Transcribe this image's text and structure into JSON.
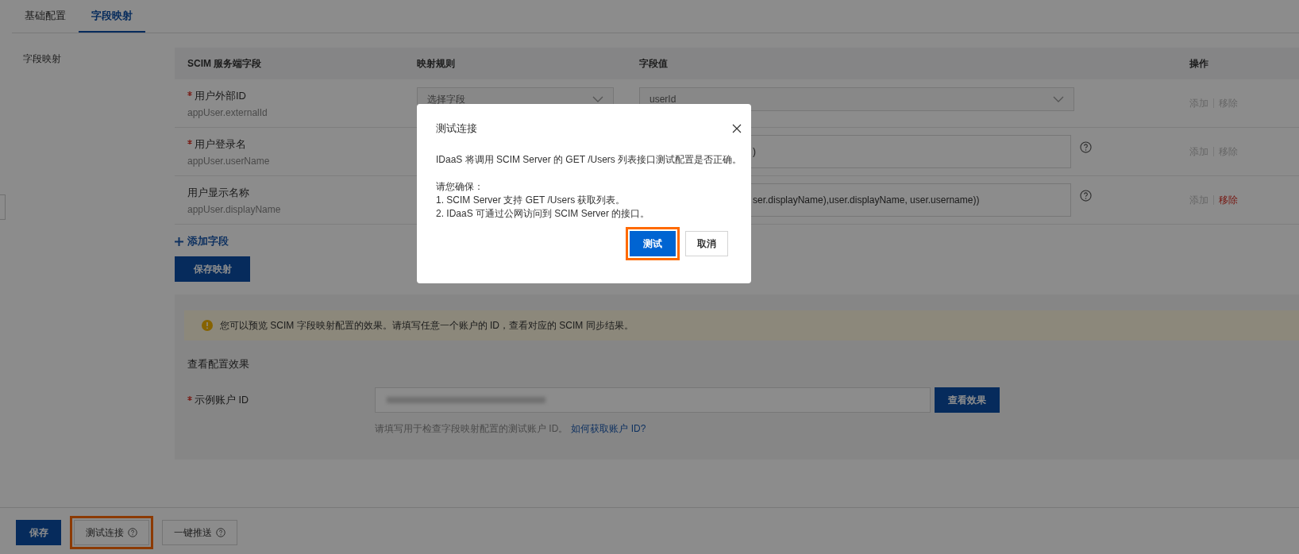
{
  "tabs": [
    {
      "label": "基础配置",
      "selected": false
    },
    {
      "label": "字段映射",
      "selected": true
    }
  ],
  "section_label": "字段映射",
  "table": {
    "columns": [
      "SCIM 服务端字段",
      "映射规则",
      "字段值",
      "操作"
    ],
    "rows": [
      {
        "required": true,
        "name": "用户外部ID",
        "attribute": "appUser.externalId",
        "rule": {
          "kind": "select",
          "placeholder": "选择字段"
        },
        "value": {
          "kind": "select",
          "text": "userId"
        },
        "help": false,
        "actions": [
          {
            "label": "添加",
            "disabled": true
          },
          {
            "label": "移除",
            "disabled": true
          }
        ]
      },
      {
        "required": true,
        "name": "用户登录名",
        "attribute": "appUser.userName",
        "value": {
          "kind": "text",
          "text": ")"
        },
        "help": true,
        "actions": [
          {
            "label": "添加",
            "disabled": true
          },
          {
            "label": "移除",
            "disabled": true
          }
        ]
      },
      {
        "required": false,
        "name": "用户显示名称",
        "attribute": "appUser.displayName",
        "value": {
          "kind": "text",
          "text": "ser.displayName),user.displayName, user.username))"
        },
        "help": true,
        "actions": [
          {
            "label": "添加",
            "disabled": true
          },
          {
            "label": "移除",
            "disabled": false
          }
        ]
      }
    ]
  },
  "add_field": "添加字段",
  "save_mapping": "保存映射",
  "preview": {
    "alert": "您可以预览 SCIM 字段映射配置的效果。请填写任意一个账户的 ID，查看对应的 SCIM 同步结果。",
    "heading": "查看配置效果",
    "field_label": "示例账户 ID",
    "required": true,
    "button": "查看效果",
    "hint": "请填写用于检查字段映射配置的测试账户 ID。",
    "hint_link": "如何获取账户 ID?"
  },
  "footer_buttons": [
    {
      "label": "保存",
      "kind": "primary",
      "help": false,
      "highlighted": false
    },
    {
      "label": "测试连接",
      "kind": "default",
      "help": true,
      "highlighted": true
    },
    {
      "label": "一键推送",
      "kind": "default",
      "help": true,
      "highlighted": false
    }
  ],
  "dialog": {
    "title": "测试连接",
    "intro": "IDaaS 将调用 SCIM Server 的 GET /Users 列表接口测试配置是否正确。",
    "lead": "请您确保：",
    "items": [
      "1. SCIM Server 支持 GET /Users 获取列表。",
      "2. IDaaS 可通过公网访问到 SCIM Server 的接口。"
    ],
    "buttons": [
      {
        "label": "测试",
        "kind": "primary",
        "highlighted": true
      },
      {
        "label": "取消",
        "kind": "default",
        "highlighted": false
      }
    ]
  }
}
